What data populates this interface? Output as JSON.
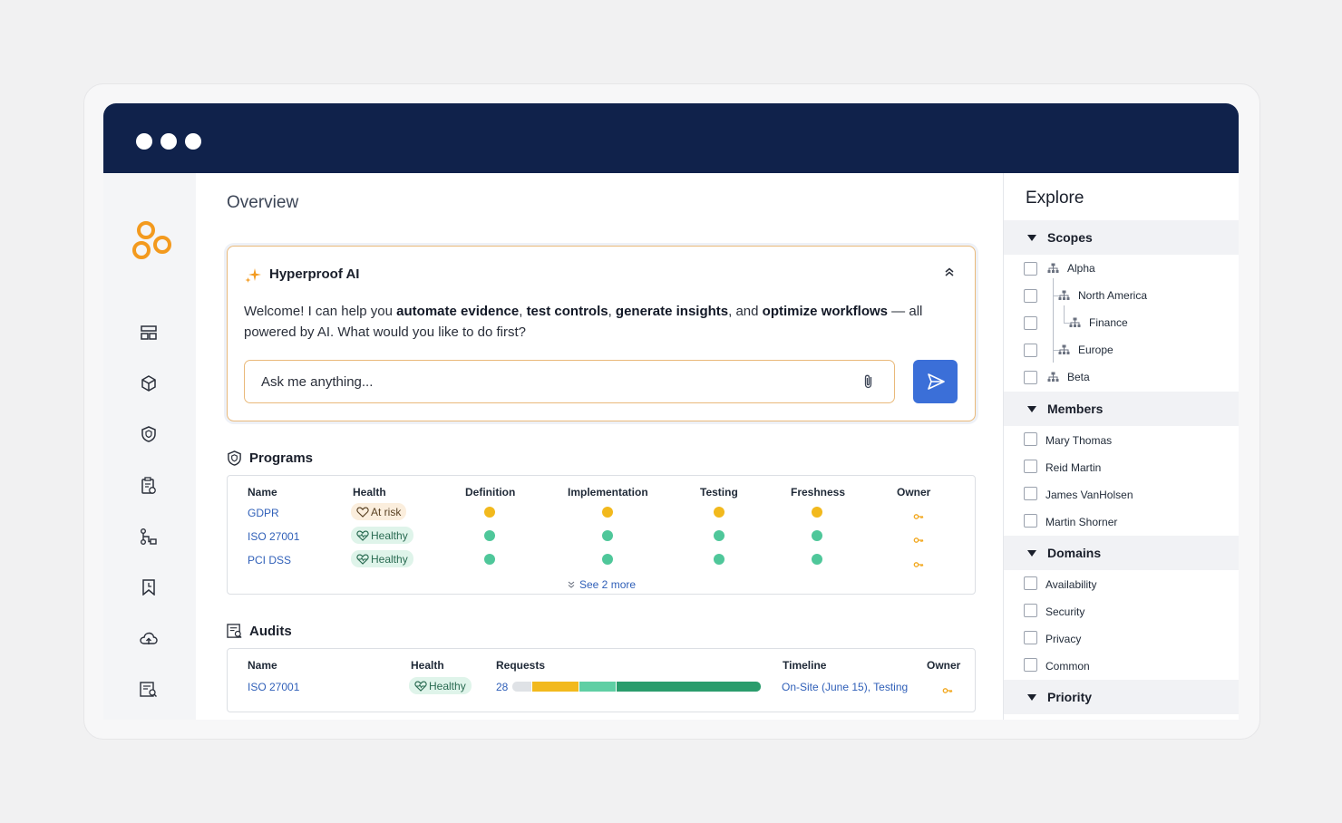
{
  "colors": {
    "titlebar": "#10224b",
    "accent_orange": "#f39a1e",
    "send_button": "#3b6fd8",
    "link": "#2f5fb8",
    "health_yellow": "#f2b91d",
    "health_green": "#4fc79a",
    "bar_yellow": "#f2b91d",
    "bar_light_green": "#5fcfa4",
    "bar_dark_green": "#2a9c6c"
  },
  "sidebar": {
    "items": [
      {
        "icon": "dashboard-icon"
      },
      {
        "icon": "cube-icon"
      },
      {
        "icon": "shield-icon"
      },
      {
        "icon": "clipboard-icon"
      },
      {
        "icon": "workflow-icon"
      },
      {
        "icon": "bookmark-icon"
      },
      {
        "icon": "cloud-upload-icon"
      },
      {
        "icon": "report-search-icon"
      }
    ]
  },
  "main": {
    "page_title": "Overview",
    "ai": {
      "title": "Hyperproof AI",
      "welcome_1": "Welcome! I can help you ",
      "bold_1": "automate evidence",
      "sep_1": ", ",
      "bold_2": "test controls",
      "sep_2": ", ",
      "bold_3": "generate insights",
      "sep_3": ", and ",
      "bold_4": "optimize workflows",
      "welcome_2": " — all powered by AI. What would you like to do first?",
      "input_placeholder": "Ask me anything..."
    },
    "programs": {
      "title": "Programs",
      "headers": [
        "Name",
        "Health",
        "Definition",
        "Implementation",
        "Testing",
        "Freshness",
        "Owner"
      ],
      "rows": [
        {
          "name": "GDPR",
          "health": "At risk",
          "status": [
            "yellow",
            "yellow",
            "yellow",
            "yellow"
          ]
        },
        {
          "name": "ISO 27001",
          "health": "Healthy",
          "status": [
            "green",
            "green",
            "green",
            "green"
          ]
        },
        {
          "name": "PCI DSS",
          "health": "Healthy",
          "status": [
            "green",
            "green",
            "green",
            "green"
          ]
        }
      ],
      "see_more": "See 2 more"
    },
    "audits": {
      "title": "Audits",
      "headers": [
        "Name",
        "Health",
        "Requests",
        "Timeline",
        "Owner"
      ],
      "rows": [
        {
          "name": "ISO 27001",
          "health": "Healthy",
          "requests": "28",
          "request_progress": {
            "not_started": 0.08,
            "yellow": 0.19,
            "light_green": 0.15,
            "dark_green": 0.58
          },
          "timeline": "On-Site (June 15), Testing"
        }
      ]
    }
  },
  "explore": {
    "title": "Explore",
    "scopes": {
      "label": "Scopes",
      "items": [
        "Alpha",
        "North America",
        "Finance",
        "Europe",
        "Beta"
      ]
    },
    "members": {
      "label": "Members",
      "items": [
        "Mary Thomas",
        "Reid Martin",
        "James VanHolsen",
        "Martin Shorner"
      ]
    },
    "domains": {
      "label": "Domains",
      "items": [
        "Availability",
        "Security",
        "Privacy",
        "Common"
      ]
    },
    "priority": {
      "label": "Priority"
    }
  }
}
